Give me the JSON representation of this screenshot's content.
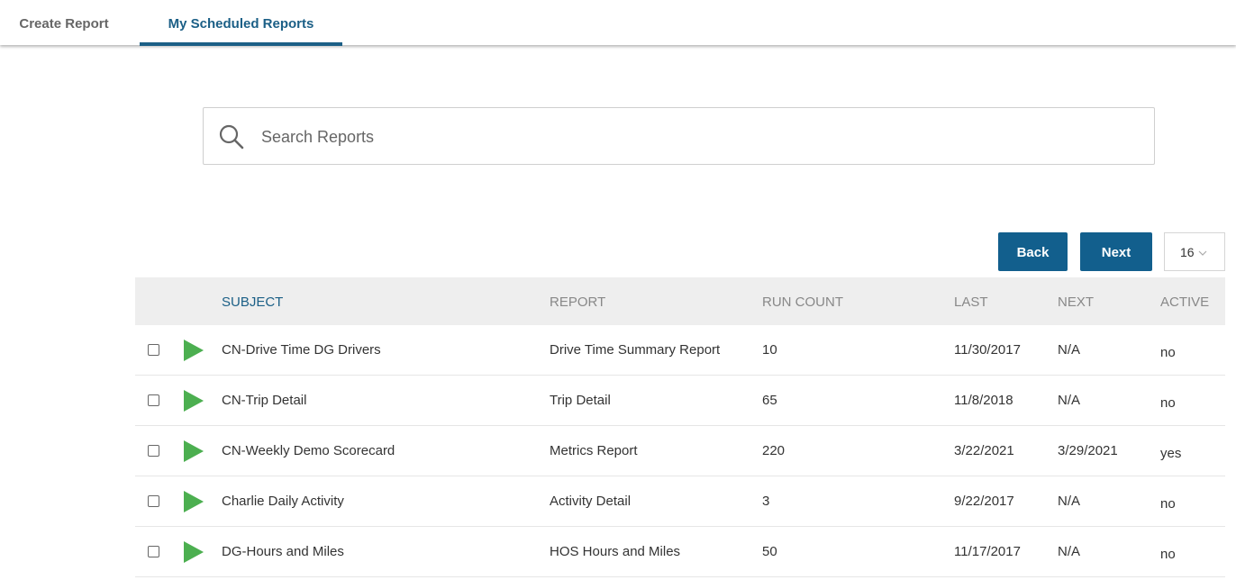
{
  "tabs": [
    {
      "label": "Create Report"
    },
    {
      "label": "My Scheduled Reports",
      "active": true
    }
  ],
  "search": {
    "placeholder": "Search Reports",
    "value": ""
  },
  "pagination": {
    "back_label": "Back",
    "next_label": "Next",
    "page_size": "16"
  },
  "columns": {
    "subject": "SUBJECT",
    "report": "REPORT",
    "run_count": "RUN COUNT",
    "last": "LAST",
    "next": "NEXT",
    "active": "ACTIVE"
  },
  "rows": [
    {
      "subject": "CN-Drive Time DG Drivers",
      "report": "Drive Time Summary Report",
      "run_count": "10",
      "last": "11/30/2017",
      "next": "N/A",
      "active": "no"
    },
    {
      "subject": "CN-Trip Detail",
      "report": "Trip Detail",
      "run_count": "65",
      "last": "11/8/2018",
      "next": "N/A",
      "active": "no"
    },
    {
      "subject": "CN-Weekly Demo Scorecard",
      "report": "Metrics Report",
      "run_count": "220",
      "last": "3/22/2021",
      "next": "3/29/2021",
      "active": "yes"
    },
    {
      "subject": "Charlie Daily Activity",
      "report": "Activity Detail",
      "run_count": "3",
      "last": "9/22/2017",
      "next": "N/A",
      "active": "no"
    },
    {
      "subject": "DG-Hours and Miles",
      "report": "HOS Hours and Miles",
      "run_count": "50",
      "last": "11/17/2017",
      "next": "N/A",
      "active": "no"
    }
  ],
  "colors": {
    "accent": "#125f8d",
    "play": "#4caf50",
    "header_bg": "#eeeeee"
  },
  "icons": {
    "search": "search-icon",
    "play": "play-icon",
    "dropdown": "chevron-down-icon"
  }
}
